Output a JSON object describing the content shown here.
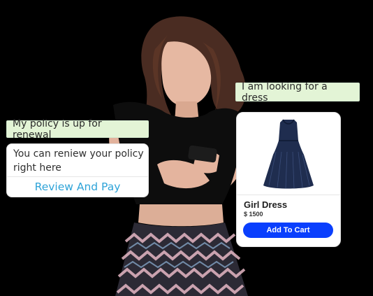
{
  "chat": {
    "user_message_dress": "I am looking for a dress",
    "user_message_policy": "My policy is up for renewal",
    "bot_reply": "You can reniew your policy right here",
    "bot_action_label": "Review And Pay"
  },
  "product": {
    "name": "Girl Dress",
    "price": "$ 1500",
    "button_label": "Add To Cart",
    "image_icon": "dress-icon"
  },
  "colors": {
    "user_bubble": "#e3f4d6",
    "link_text": "#2ea3d8",
    "cart_button": "#0a3ffd",
    "background": "#000000"
  }
}
